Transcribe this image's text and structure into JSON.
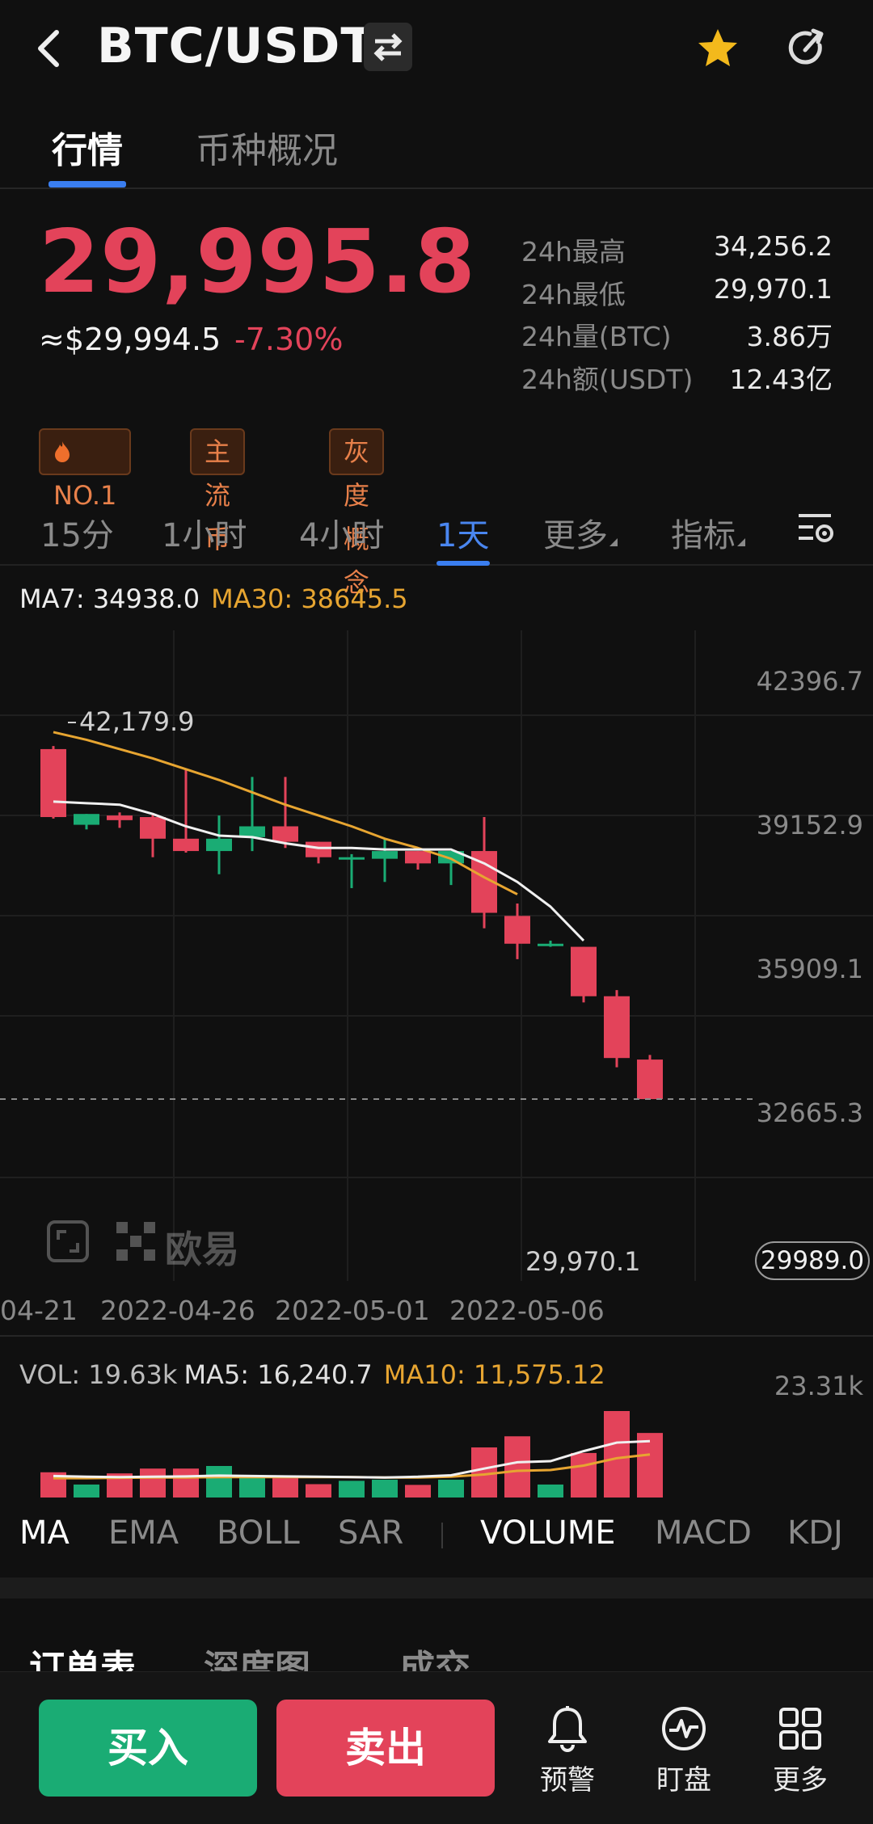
{
  "header": {
    "title": "BTC/USDT"
  },
  "tabs": [
    {
      "label": "行情"
    },
    {
      "label": "币种概况"
    }
  ],
  "ticker": {
    "last_price": "29,995.8",
    "usd_price": "≈$29,994.5",
    "change_pct": "-7.30%",
    "stats": [
      {
        "label": "24h最高",
        "value": "34,256.2"
      },
      {
        "label": "24h最低",
        "value": "29,970.1"
      },
      {
        "label": "24h量(BTC)",
        "value": "3.86万"
      },
      {
        "label": "24h额(USDT)",
        "value": "12.43亿"
      }
    ]
  },
  "badges": [
    "NO.1",
    "主流币",
    "灰度概念"
  ],
  "intervals": [
    "15分",
    "1小时",
    "4小时",
    "1天",
    "更多",
    "指标"
  ],
  "active_interval": "1天",
  "ma_legend": {
    "ma7": "MA7: 34938.0",
    "ma30": "MA30: 38645.5"
  },
  "chart_data": {
    "type": "candlestick",
    "y_ticks": [
      "42396.7",
      "39152.9",
      "35909.1",
      "32665.3"
    ],
    "y_tick_values": [
      42396.7,
      39152.9,
      35909.1,
      32665.3
    ],
    "x_tick_labels": [
      "04-21",
      "2022-04-26",
      "2022-05-01",
      "2022-05-06"
    ],
    "high_marker": "42,179.9",
    "low_marker": "29,970.1",
    "last_price_tag": "29989.0",
    "candles": [
      {
        "open": 41300,
        "close": 39100,
        "high": 41400,
        "low": 39050
      },
      {
        "open": 38850,
        "close": 39200,
        "high": 39200,
        "low": 38700
      },
      {
        "open": 39150,
        "close": 39000,
        "high": 39250,
        "low": 38750
      },
      {
        "open": 39100,
        "close": 38400,
        "high": 39200,
        "low": 37800
      },
      {
        "open": 38400,
        "close": 38000,
        "high": 40650,
        "low": 37950
      },
      {
        "open": 38000,
        "close": 38400,
        "high": 39150,
        "low": 37250
      },
      {
        "open": 38450,
        "close": 38800,
        "high": 40400,
        "low": 38000
      },
      {
        "open": 38800,
        "close": 38300,
        "high": 40400,
        "low": 38100
      },
      {
        "open": 38300,
        "close": 37800,
        "high": 38300,
        "low": 37600
      },
      {
        "open": 37750,
        "close": 37800,
        "high": 37900,
        "low": 36800
      },
      {
        "open": 37750,
        "close": 38000,
        "high": 38400,
        "low": 37000
      },
      {
        "open": 38000,
        "close": 37600,
        "high": 38000,
        "low": 37400
      },
      {
        "open": 37600,
        "close": 38000,
        "high": 38000,
        "low": 36900
      },
      {
        "open": 38000,
        "close": 36000,
        "high": 39100,
        "low": 35500
      },
      {
        "open": 35900,
        "close": 35000,
        "high": 36300,
        "low": 34500
      },
      {
        "open": 35000,
        "close": 35000,
        "high": 35100,
        "low": 34900
      },
      {
        "open": 34900,
        "close": 33300,
        "high": 34900,
        "low": 33100
      },
      {
        "open": 33300,
        "close": 31300,
        "high": 33500,
        "low": 31000
      },
      {
        "open": 31250,
        "close": 29970,
        "high": 31400,
        "low": 29970
      }
    ],
    "ma7": [
      39600,
      39550,
      39500,
      39200,
      38800,
      38500,
      38450,
      38250,
      38100,
      38100,
      38050,
      38050,
      38050,
      37600,
      37000,
      36200,
      35100
    ],
    "ma30": [
      41850,
      41600,
      41300,
      41000,
      40650,
      40300,
      39900,
      39500,
      39150,
      38800,
      38400,
      38100,
      37750,
      37150,
      36600
    ],
    "volume": {
      "legend_vol": "VOL: 19.63k",
      "legend_ma5": "MA5: 16,240.7",
      "legend_ma10": "MA10: 11,575.12",
      "max_label": "23.31k",
      "max": 23310,
      "bars": [
        6800,
        3500,
        6500,
        7800,
        7800,
        8500,
        6000,
        5200,
        3600,
        4500,
        4800,
        3400,
        4800,
        13500,
        16500,
        3500,
        12000,
        23310,
        17400
      ],
      "ma5": [
        5800,
        5600,
        5500,
        5600,
        5700,
        5900,
        5800,
        5700,
        5600,
        5500,
        5400,
        5600,
        6000,
        7800,
        9500,
        9800,
        12500,
        14800,
        15200
      ],
      "ma10": [
        5200,
        5200,
        5300,
        5400,
        5400,
        5500,
        5500,
        5500,
        5500,
        5500,
        5400,
        5400,
        5600,
        6200,
        7200,
        7400,
        8600,
        10600,
        11600
      ]
    }
  },
  "watermark_text": "欧易",
  "indicators": [
    "MA",
    "EMA",
    "BOLL",
    "SAR",
    "VOLUME",
    "MACD",
    "KDJ"
  ],
  "book_tabs": [
    "订单表",
    "深度图",
    "成交"
  ],
  "bottom": {
    "buy": "买入",
    "sell": "卖出",
    "alert": "预警",
    "watch": "盯盘",
    "more": "更多"
  },
  "colors": {
    "up": "#1aac74",
    "down": "#e3435a",
    "accent": "#3a7ef0",
    "ma30": "#e7a531"
  }
}
